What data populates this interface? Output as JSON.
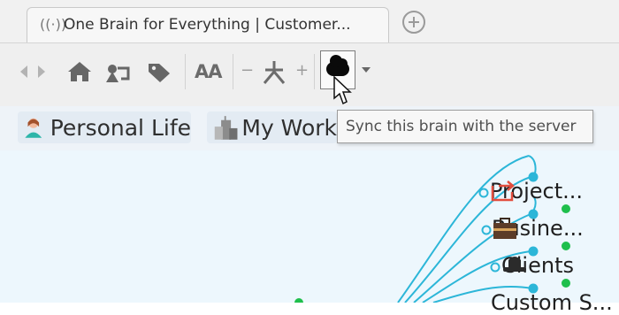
{
  "tab": {
    "title": "One Brain for Everything | Customer...",
    "icon": "broadcast-icon"
  },
  "toolbar": {
    "icons": [
      "back-icon",
      "forward-icon",
      "home-icon",
      "outline-icon",
      "tag-icon",
      "font-size-icon",
      "zoom-out-icon",
      "layout-icon",
      "zoom-in-icon",
      "cloud-sync-icon",
      "dropdown-caret-icon"
    ],
    "font_size_label": "AA",
    "zoom_minus": "−",
    "zoom_plus": "+"
  },
  "bookmarks": [
    {
      "label": "Personal Life",
      "icon": "person-icon"
    },
    {
      "label": "My Work",
      "icon": "building-icon"
    }
  ],
  "tooltip": {
    "text": "Sync this brain with the server"
  },
  "mindmap": {
    "line_color": "#2cb6d8",
    "accent_green": "#1fbf4c",
    "nodes": [
      {
        "label": "Project...",
        "icon": "project-icon"
      },
      {
        "label": "Busine...",
        "icon": "briefcase-icon"
      },
      {
        "label": "Clients",
        "icon": "hat-icon"
      },
      {
        "label": "Custom S...",
        "icon": ""
      }
    ]
  }
}
